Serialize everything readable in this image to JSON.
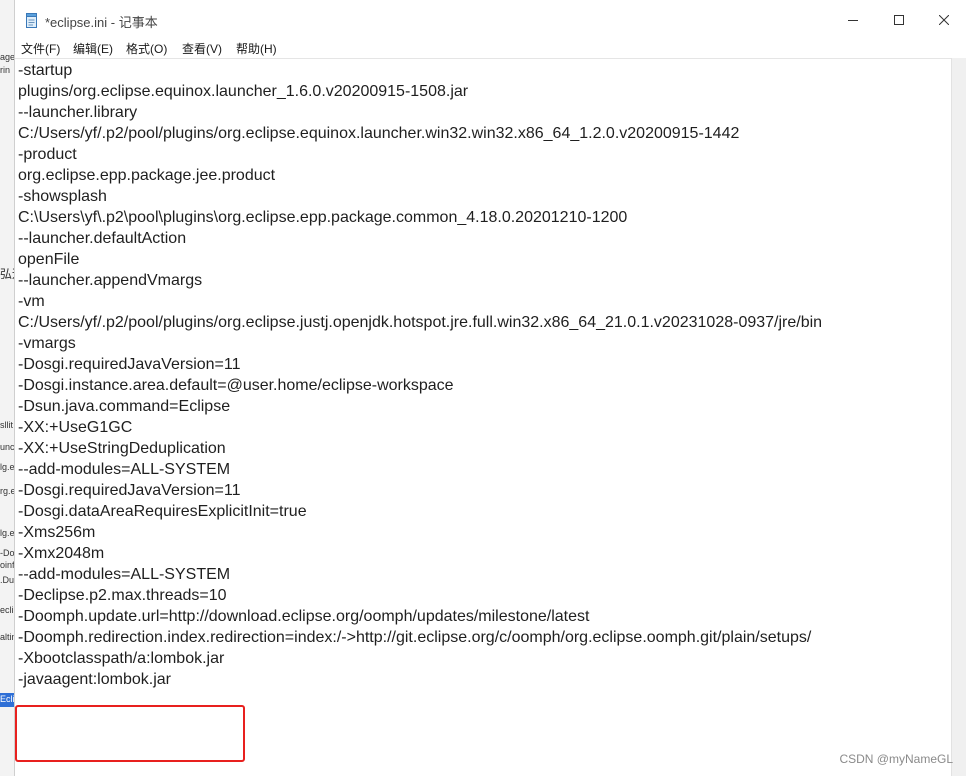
{
  "window": {
    "title": "*eclipse.ini - 记事本",
    "minimize_icon": "minimize-icon",
    "maximize_icon": "maximize-icon",
    "close_icon": "close-icon"
  },
  "menu": [
    {
      "label": "文件(F)"
    },
    {
      "label": "编辑(E)"
    },
    {
      "label": "格式(O)"
    },
    {
      "label": "查看(V)"
    },
    {
      "label": "帮助(H)"
    }
  ],
  "backdrop_fragments": [
    "age",
    "rin",
    "弘运",
    "sllit",
    "unche",
    "lg.ed",
    "rg.ec",
    "lg.ec",
    "-Dosg",
    "oinfb",
    ".Duse",
    "eclip",
    "altini",
    "Eclip"
  ],
  "lines": [
    "-startup",
    "plugins/org.eclipse.equinox.launcher_1.6.0.v20200915-1508.jar",
    "--launcher.library",
    "C:/Users/yf/.p2/pool/plugins/org.eclipse.equinox.launcher.win32.win32.x86_64_1.2.0.v20200915-1442",
    "-product",
    "org.eclipse.epp.package.jee.product",
    "-showsplash",
    "C:\\Users\\yf\\.p2\\pool\\plugins\\org.eclipse.epp.package.common_4.18.0.20201210-1200",
    "--launcher.defaultAction",
    "openFile",
    "--launcher.appendVmargs",
    "-vm",
    "C:/Users/yf/.p2/pool/plugins/org.eclipse.justj.openjdk.hotspot.jre.full.win32.x86_64_21.0.1.v20231028-0937/jre/bin",
    "-vmargs",
    "-Dosgi.requiredJavaVersion=11",
    "-Dosgi.instance.area.default=@user.home/eclipse-workspace",
    "-Dsun.java.command=Eclipse",
    "-XX:+UseG1GC",
    "-XX:+UseStringDeduplication",
    "--add-modules=ALL-SYSTEM",
    "-Dosgi.requiredJavaVersion=11",
    "-Dosgi.dataAreaRequiresExplicitInit=true",
    "-Xms256m",
    "-Xmx2048m",
    "--add-modules=ALL-SYSTEM",
    "-Declipse.p2.max.threads=10",
    "-Doomph.update.url=http://download.eclipse.org/oomph/updates/milestone/latest",
    "-Doomph.redirection.index.redirection=index:/->http://git.eclipse.org/c/oomph/org.eclipse.oomph.git/plain/setups/",
    "-Xbootclasspath/a:lombok.jar",
    "-javaagent:lombok.jar"
  ],
  "annotation": {
    "color": "#e8201e",
    "highlighted_lines": [
      "-Xbootclasspath/a:lombok.jar",
      "-javaagent:lombok.jar"
    ]
  },
  "watermark": "CSDN @myNameGL"
}
